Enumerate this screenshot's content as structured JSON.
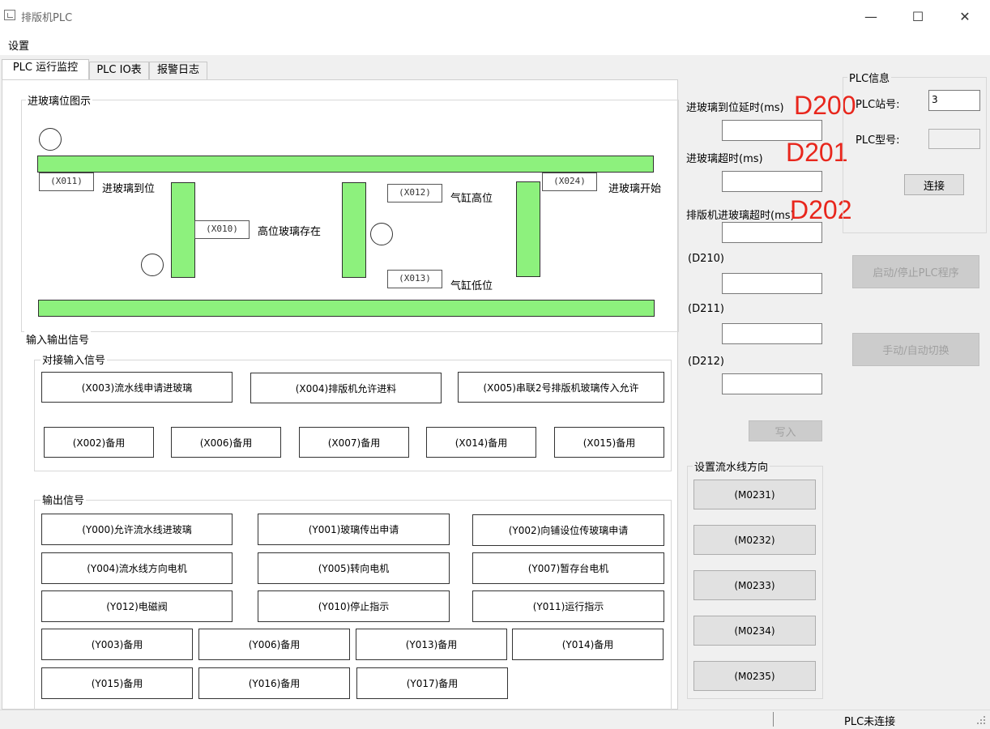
{
  "window": {
    "title": "排版机PLC"
  },
  "menu": {
    "settings": "设置"
  },
  "tabs": [
    {
      "label": "PLC 运行监控"
    },
    {
      "label": "PLC IO表"
    },
    {
      "label": "报警日志"
    }
  ],
  "diagram": {
    "title": "进玻璃位图示",
    "tags": {
      "x011": "(X011)",
      "x010": "(X010)",
      "x012": "(X012)",
      "x013": "(X013)",
      "x024": "(X024)"
    },
    "labels": {
      "glass_arrived": "进玻璃到位",
      "high_glass": "高位玻璃存在",
      "cyl_high": "气缸高位",
      "cyl_low": "气缸低位",
      "glass_start": "进玻璃开始"
    }
  },
  "io": {
    "title": "输入输出信号",
    "input": {
      "title": "对接输入信号",
      "row1": [
        "(X003)流水线申请进玻璃",
        "(X004)排版机允许进料",
        "(X005)串联2号排版机玻璃传入允许"
      ],
      "row2": [
        "(X002)备用",
        "(X006)备用",
        "(X007)备用",
        "(X014)备用",
        "(X015)备用"
      ]
    },
    "output": {
      "title": "输出信号",
      "row1": [
        "(Y000)允许流水线进玻璃",
        "(Y001)玻璃传出申请",
        "(Y002)向铺设位传玻璃申请"
      ],
      "row2": [
        "(Y004)流水线方向电机",
        "(Y005)转向电机",
        "(Y007)暂存台电机"
      ],
      "row3": [
        "(Y012)电磁阀",
        "(Y010)停止指示",
        "(Y011)运行指示"
      ],
      "row4": [
        "(Y003)备用",
        "(Y006)备用",
        "(Y013)备用",
        "(Y014)备用"
      ],
      "row5": [
        "(Y015)备用",
        "(Y016)备用",
        "(Y017)备用"
      ]
    }
  },
  "params": {
    "p1_label": "进玻璃到位延时(ms)",
    "p2_label": "进玻璃超时(ms)",
    "p3_label": "排版机进玻璃超时(ms)",
    "p4_label": "(D210)",
    "p5_label": "(D211)",
    "p6_label": "(D212)",
    "values": [
      "",
      "",
      "",
      "",
      "",
      ""
    ],
    "annotations": [
      "D200",
      "D201",
      "D202"
    ],
    "write_button": "写入"
  },
  "direction": {
    "title": "设置流水线方向",
    "buttons": [
      "(M0231)",
      "(M0232)",
      "(M0233)",
      "(M0234)",
      "(M0235)"
    ]
  },
  "plc_info": {
    "title": "PLC信息",
    "station_label": "PLC站号:",
    "station_value": "3",
    "model_label": "PLC型号:",
    "model_value": "",
    "connect_button": "连接"
  },
  "actions": {
    "start_stop": "启动/停止PLC程序",
    "manual_auto": "手动/自动切换"
  },
  "status": {
    "text": "PLC未连接"
  },
  "colors": {
    "sensor_green": "#8df17d",
    "annotation_red": "#e8261c"
  }
}
